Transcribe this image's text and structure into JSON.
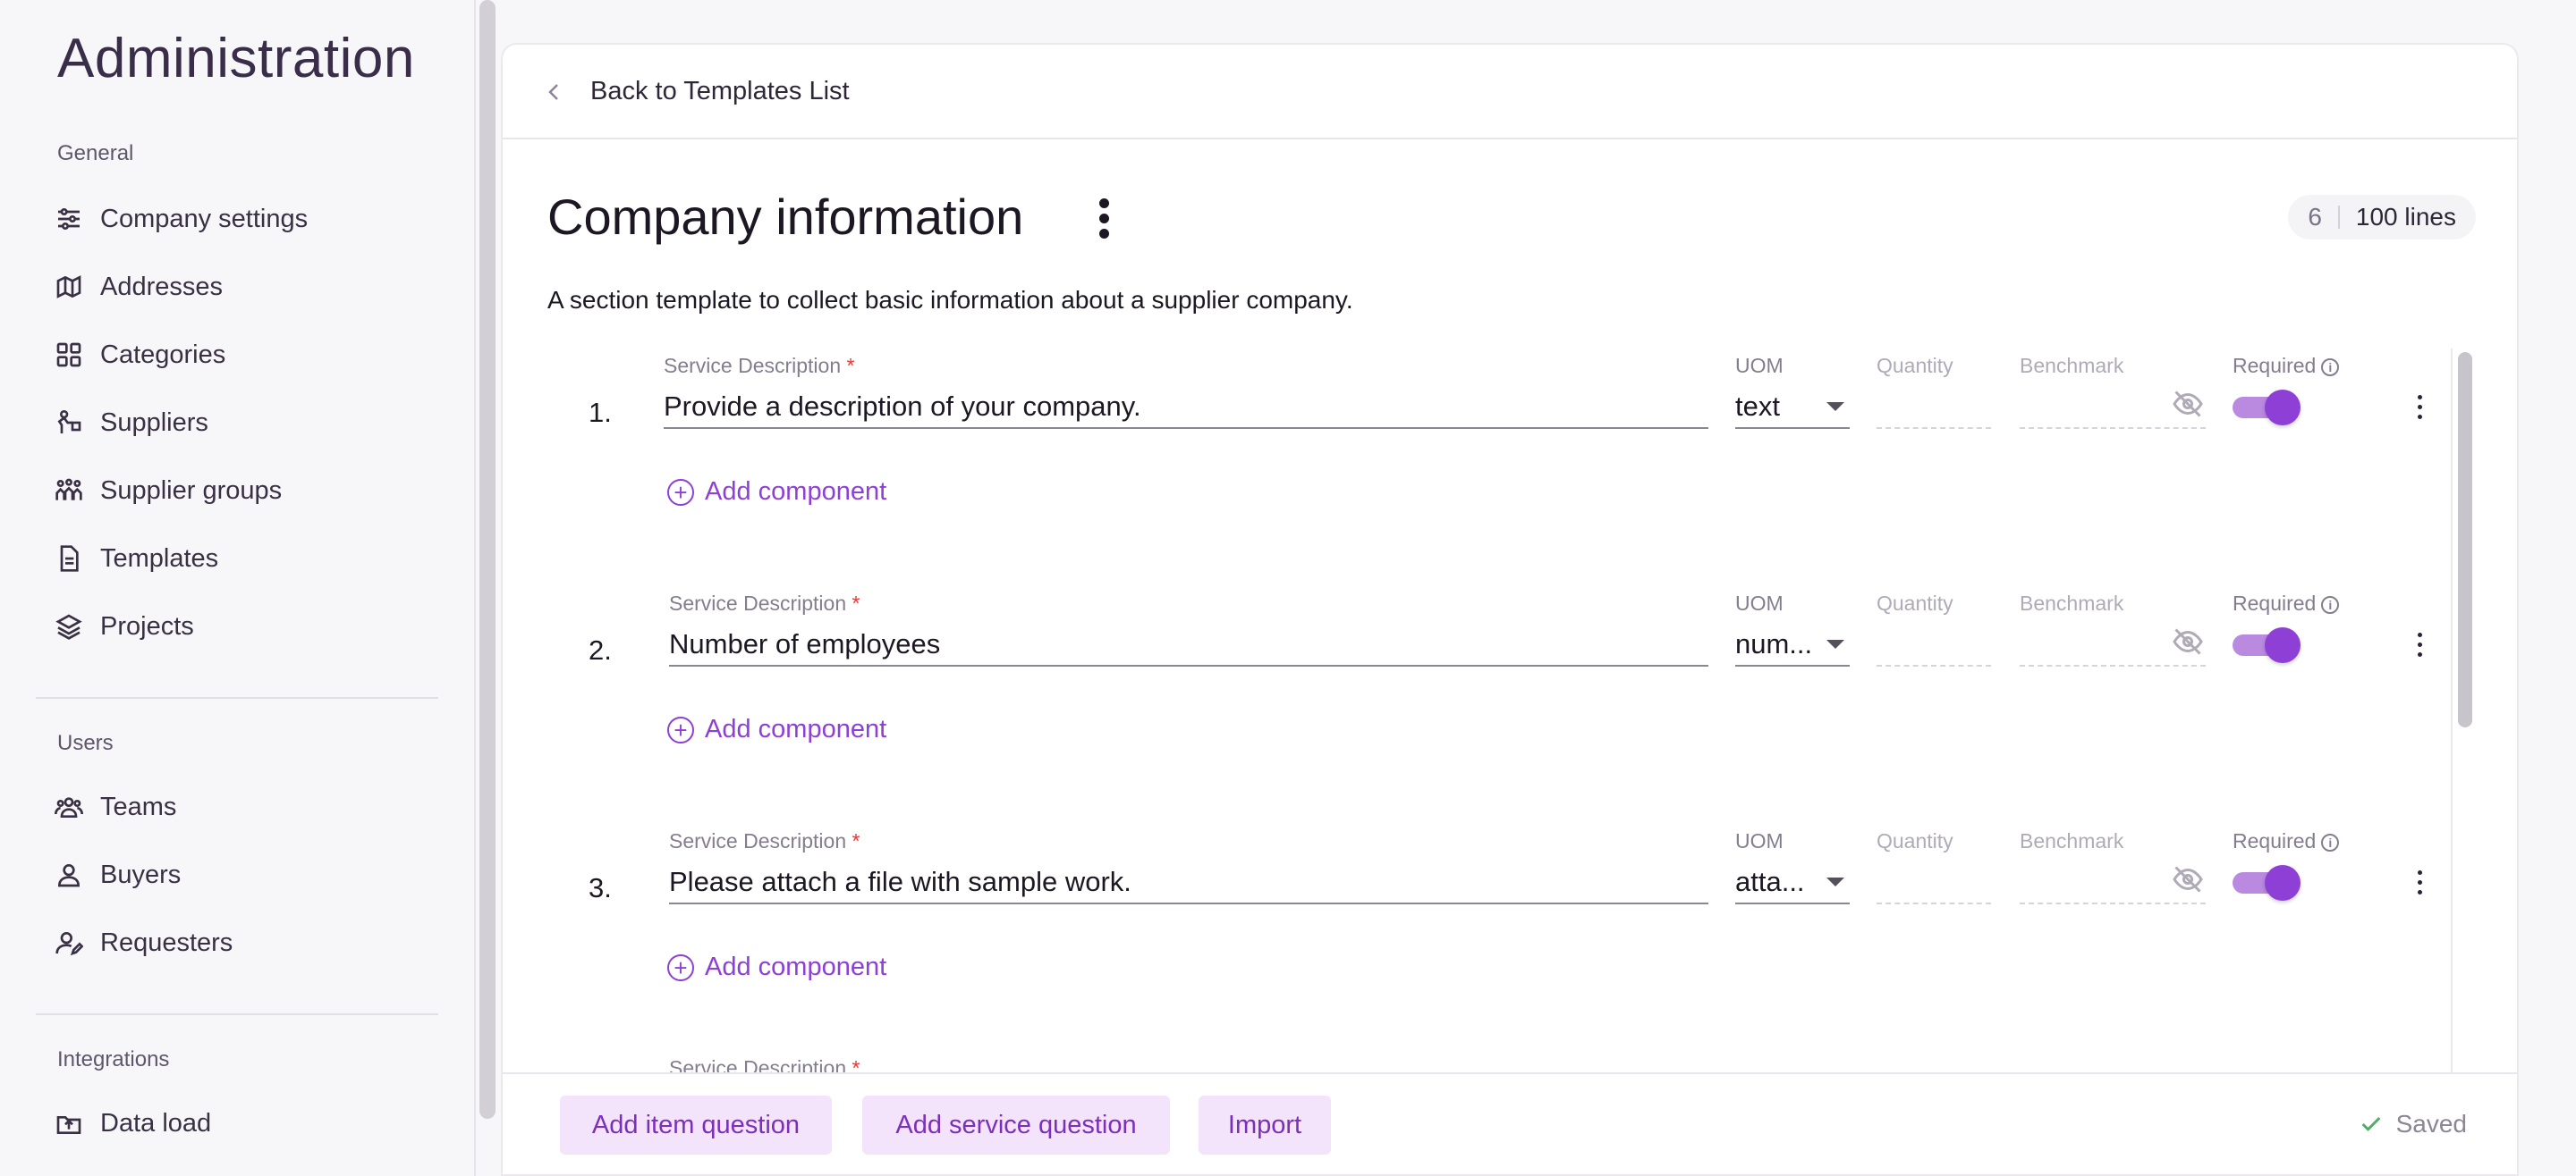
{
  "sidebar": {
    "title": "Administration",
    "sections": [
      {
        "label": "General"
      },
      {
        "label": "Users"
      },
      {
        "label": "Integrations"
      }
    ],
    "items": [
      {
        "label": "Company settings",
        "icon": "sliders-icon"
      },
      {
        "label": "Addresses",
        "icon": "map-icon"
      },
      {
        "label": "Categories",
        "icon": "grid-icon"
      },
      {
        "label": "Suppliers",
        "icon": "supplier-icon"
      },
      {
        "label": "Supplier groups",
        "icon": "group-icon"
      },
      {
        "label": "Templates",
        "icon": "document-icon"
      },
      {
        "label": "Projects",
        "icon": "layers-icon"
      },
      {
        "label": "Teams",
        "icon": "team-icon"
      },
      {
        "label": "Buyers",
        "icon": "user-icon"
      },
      {
        "label": "Requesters",
        "icon": "user-edit-icon"
      },
      {
        "label": "Data load",
        "icon": "upload-icon"
      }
    ]
  },
  "header": {
    "back_label": "Back to Templates List"
  },
  "template": {
    "title": "Company information",
    "count": "6",
    "lines": "100 lines",
    "description": "A section template to collect basic information about a supplier company."
  },
  "labels": {
    "service_description": "Service Description",
    "required_star": "*",
    "uom": "UOM",
    "quantity": "Quantity",
    "benchmark": "Benchmark",
    "required": "Required",
    "add_component": "Add component"
  },
  "rows": [
    {
      "number": "1.",
      "description": "Provide a description of your company.",
      "uom": "text",
      "required": true
    },
    {
      "number": "2.",
      "description": "Number of employees",
      "uom": "num...",
      "required": true
    },
    {
      "number": "3.",
      "description": "Please attach a file with sample work.",
      "uom": "atta...",
      "required": true
    }
  ],
  "footer": {
    "add_item": "Add item question",
    "add_service": "Add service question",
    "import": "Import",
    "saved": "Saved"
  },
  "colors": {
    "accent": "#8e3fd6",
    "button_bg": "#f3e4fb",
    "success": "#4fae65"
  }
}
